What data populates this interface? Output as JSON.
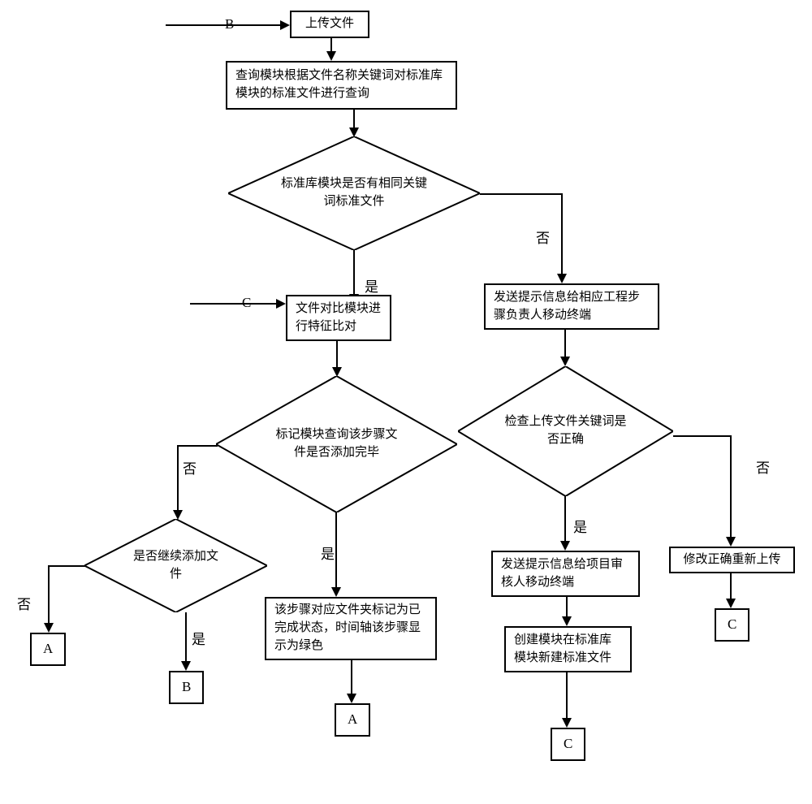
{
  "nodes": {
    "b_in": "B",
    "upload": "上传文件",
    "query": "查询模块根据文件名称关键词对标准库模块的标准文件进行查询",
    "d1": "标准库模块是否有相同关键词标准文件",
    "c_in": "C",
    "compare": "文件对比模块进行特征比对",
    "d2": "标记模块查询该步骤文件是否添加完毕",
    "d3": "是否继续添加文件",
    "mark_done": "该步骤对应文件夹标记为已完成状态，时间轴该步骤显示为绿色",
    "a1": "A",
    "b1": "B",
    "a2": "A",
    "prompt_eng": "发送提示信息给相应工程步骤负责人移动终端",
    "d4": "检查上传文件关键词是否正确",
    "reupload": "修改正确重新上传",
    "c1": "C",
    "prompt_rev": "发送提示信息给项目审核人移动终端",
    "create_std": "创建模块在标准库模块新建标准文件",
    "c2": "C"
  },
  "labels": {
    "yes": "是",
    "no": "否"
  }
}
